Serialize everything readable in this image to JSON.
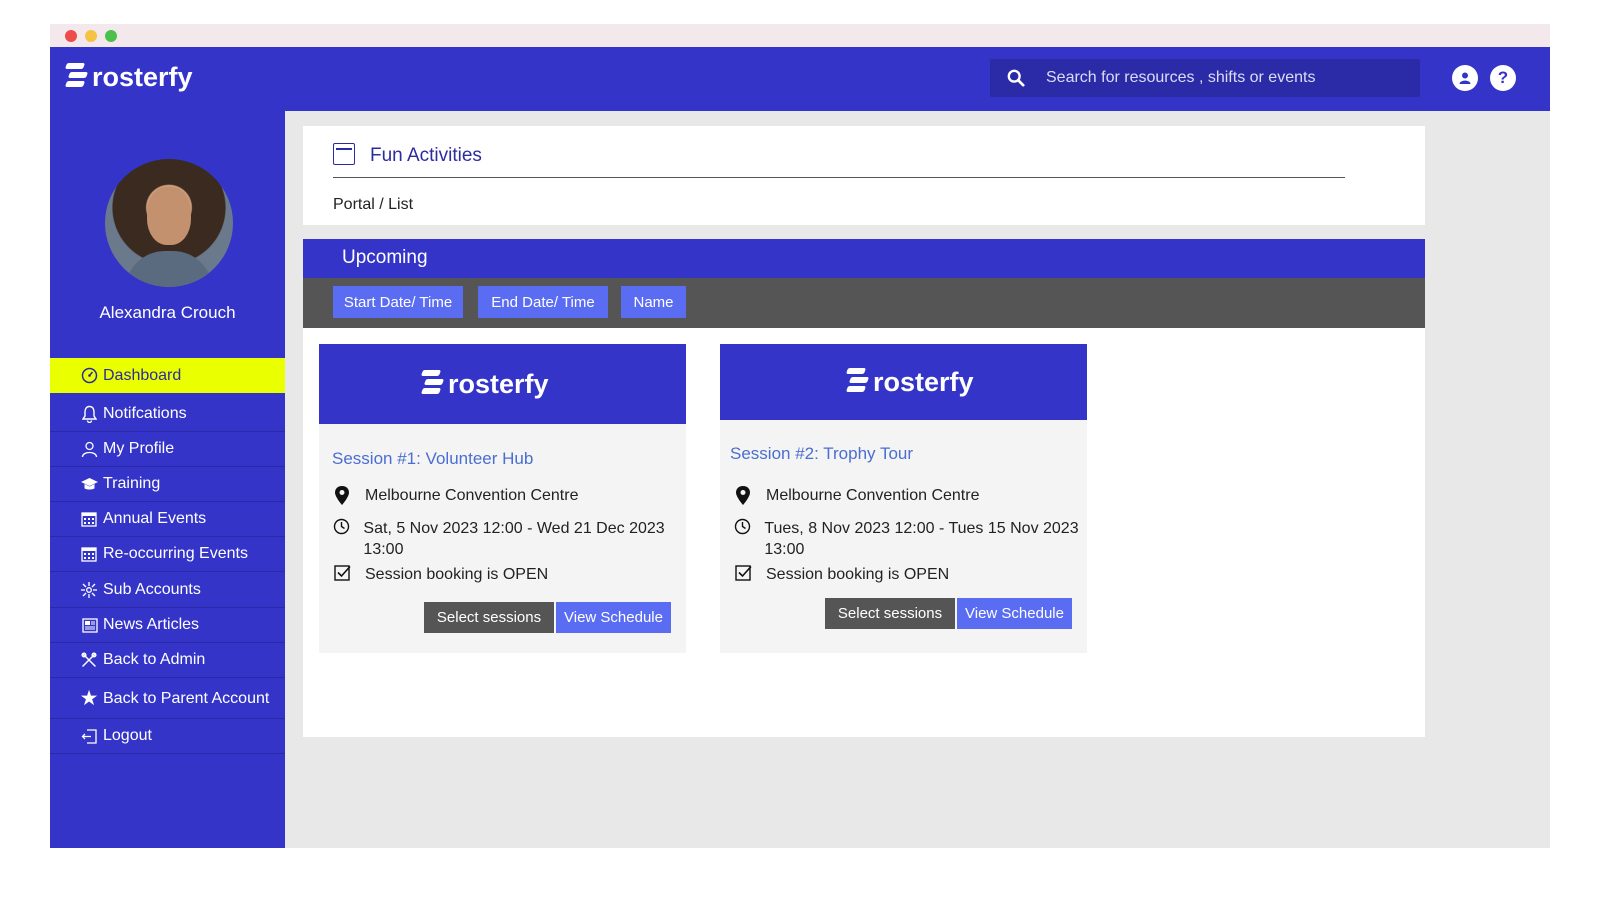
{
  "app": {
    "brand": "rosterfy"
  },
  "header": {
    "search_placeholder": "Search for resources , shifts or events",
    "help_symbol": "?"
  },
  "sidebar": {
    "user_name": "Alexandra Crouch",
    "items": [
      {
        "label": "Dashboard",
        "icon": "dashboard-icon",
        "active": true
      },
      {
        "label": "Notifcations",
        "icon": "bell-icon"
      },
      {
        "label": "My Profile",
        "icon": "person-icon"
      },
      {
        "label": "Training",
        "icon": "graduation-cap-icon"
      },
      {
        "label": "Annual Events",
        "icon": "calendar-icon"
      },
      {
        "label": "Re-occurring Events",
        "icon": "calendar-icon"
      },
      {
        "label": "Sub Accounts",
        "icon": "network-icon"
      },
      {
        "label": "News Articles",
        "icon": "newspaper-icon"
      },
      {
        "label": "Back to Admin",
        "icon": "tools-icon"
      },
      {
        "label": "Back to Parent Account",
        "icon": "star-icon"
      },
      {
        "label": "Logout",
        "icon": "logout-icon"
      }
    ]
  },
  "page": {
    "title": "Fun Activities",
    "breadcrumb": "Portal / List",
    "section_title": "Upcoming",
    "filters": [
      "Start Date/ Time",
      "End Date/ Time",
      "Name"
    ]
  },
  "sessions": [
    {
      "title": "Session #1: Volunteer Hub",
      "location": "Melbourne Convention Centre",
      "time": "Sat, 5 Nov 2023 12:00 - Wed 21 Dec 2023 13:00",
      "status": "Session booking is OPEN",
      "select_label": "Select sessions",
      "view_label": "View Schedule"
    },
    {
      "title": "Session #2: Trophy Tour",
      "location": "Melbourne Convention Centre",
      "time": "Tues, 8 Nov 2023 12:00 - Tues 15 Nov 2023 13:00",
      "status": "Session booking is OPEN",
      "select_label": "Select sessions",
      "view_label": "View Schedule"
    }
  ],
  "colors": {
    "brand_blue": "#3434c9",
    "active_highlight": "#eaff00",
    "button_blue": "#5a6cf2",
    "button_gray": "#555555",
    "link_blue": "#4a6ed1"
  }
}
